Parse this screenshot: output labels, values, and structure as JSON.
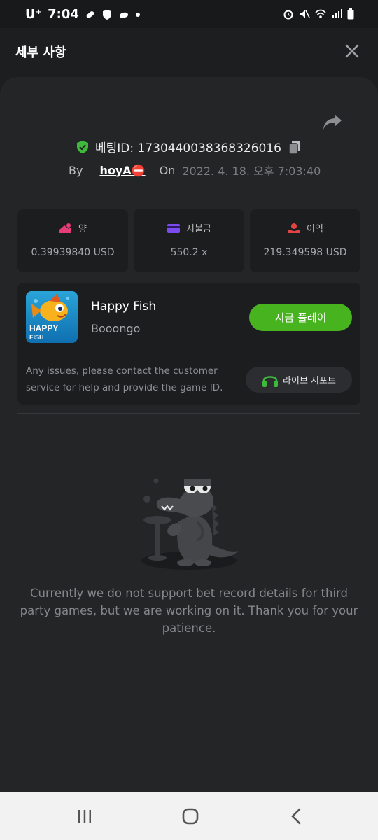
{
  "status_bar": {
    "carrier": "U⁺",
    "time": "7:04"
  },
  "header": {
    "title": "세부 사항"
  },
  "bet": {
    "id_label": "베팅ID: 1730440038368326016",
    "by_label": "By",
    "user": "hoyA⛔",
    "on_label": "On",
    "date": "2022. 4. 18. 오후 7:03:40"
  },
  "stats": [
    {
      "label": "양",
      "value": "0.39939840 USD"
    },
    {
      "label": "지불금",
      "value": "550.2 x"
    },
    {
      "label": "이익",
      "value": "219.349598 USD"
    }
  ],
  "game": {
    "thumb_text_1": "HAPPY",
    "thumb_text_2": "FISH",
    "name": "Happy Fish",
    "provider": "Booongo",
    "play_label": "지금 플레이",
    "issue_text": "Any issues, please contact the customer service for help and provide the game ID.",
    "support_label": "라이브 서포트"
  },
  "empty_message": "Currently we do not support bet record details for third party games, but we are working on it. Thank you for your patience.",
  "colors": {
    "accent_green": "#47b41f",
    "amount_icon": "#e63c78",
    "payout_icon": "#7b4bf0",
    "profit_icon": "#e24444"
  }
}
